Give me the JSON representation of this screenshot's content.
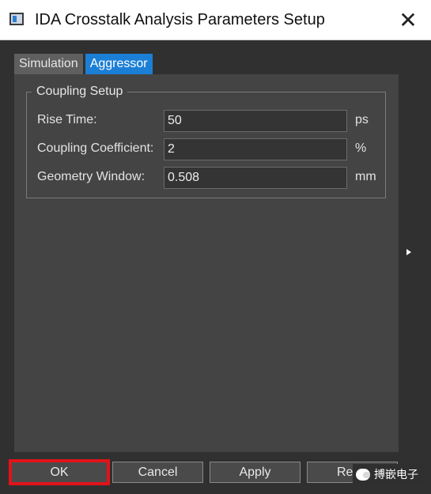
{
  "window": {
    "title": "IDA Crosstalk Analysis Parameters Setup",
    "close_glyph": "✕"
  },
  "tabs": [
    {
      "label": "Simulation",
      "active": false
    },
    {
      "label": "Aggressor",
      "active": true
    }
  ],
  "coupling_setup": {
    "group_title": "Coupling Setup",
    "rows": [
      {
        "label": "Rise Time:",
        "value": "50",
        "unit": "ps"
      },
      {
        "label": "Coupling Coefficient:",
        "value": "2",
        "unit": "%"
      },
      {
        "label": "Geometry Window:",
        "value": "0.508",
        "unit": "mm"
      }
    ]
  },
  "buttons": {
    "ok": "OK",
    "cancel": "Cancel",
    "apply": "Apply",
    "reset": "Res"
  },
  "watermark": {
    "icon": "wechat-icon",
    "text": "搏嵌电子"
  },
  "colors": {
    "accent": "#1c7fd6",
    "highlight": "#e0131b",
    "panel": "#444444",
    "background": "#303030"
  }
}
